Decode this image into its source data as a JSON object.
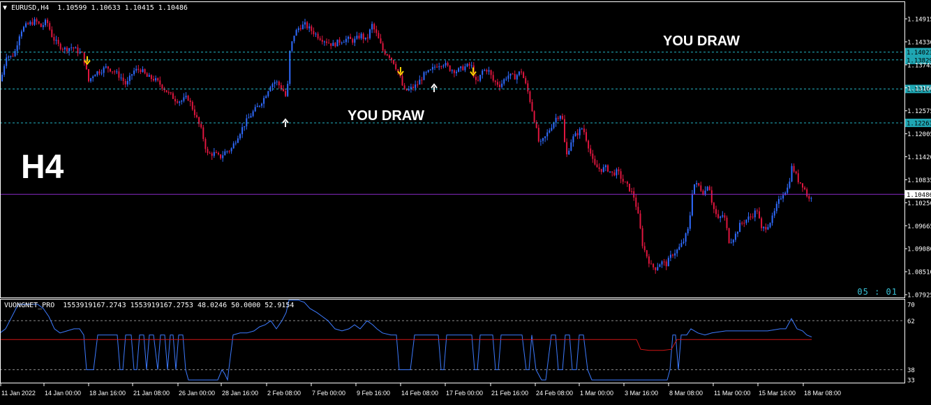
{
  "header": {
    "symbol": "EURUSD,H4",
    "ohlc": "1.10599 1.10633 1.10415 1.10486",
    "arrow_icon": "triangle-down-icon"
  },
  "overlay": {
    "timeframe": "H4",
    "label_top": "YOU DRAW",
    "label_mid": "YOU DRAW",
    "timer": "05 : 01"
  },
  "indicator": {
    "header": "VUONGNET_PRO  1553919167.2743 1553919167.2753 48.0246 50.0000 52.9154",
    "levels": [
      "70",
      "62",
      "38",
      "33"
    ],
    "colors": {
      "line": "#3d7bff",
      "signal": "#d01515",
      "level": "#8a8a8a"
    }
  },
  "chart_data": {
    "type": "candlestick",
    "symbol": "EURUSD",
    "timeframe": "H4",
    "ylim": [
      1.0792,
      1.1525
    ],
    "y_ticks": [
      "1.14915",
      "1.14330",
      "1.13745",
      "1.13160",
      "1.12575",
      "1.12005",
      "1.11420",
      "1.10835",
      "1.10250",
      "1.09665",
      "1.09080",
      "1.08510",
      "1.07925"
    ],
    "x_ticks": [
      "11 Jan 2022",
      "14 Jan 00:00",
      "18 Jan 16:00",
      "21 Jan 08:00",
      "26 Jan 00:00",
      "28 Jan 16:00",
      "2 Feb 08:00",
      "7 Feb 00:00",
      "9 Feb 16:00",
      "14 Feb 08:00",
      "17 Feb 00:00",
      "21 Feb 16:00",
      "24 Feb 08:00",
      "1 Mar 00:00",
      "3 Mar 16:00",
      "8 Mar 08:00",
      "11 Mar 00:00",
      "15 Mar 16:00",
      "18 Mar 08:00"
    ],
    "levels": [
      {
        "value": 1.14023,
        "label": "1.14023"
      },
      {
        "value": 1.13829,
        "label": "1.13829"
      },
      {
        "value": 1.13107,
        "label": "1.13107"
      },
      {
        "value": 1.12263,
        "label": "1.12263"
      }
    ],
    "current_price": {
      "value": 1.10486,
      "label": "1.10486"
    },
    "price_path": [
      [
        0,
        1.133
      ],
      [
        8,
        1.1395
      ],
      [
        14,
        1.139
      ],
      [
        20,
        1.14
      ],
      [
        28,
        1.1455
      ],
      [
        38,
        1.147
      ],
      [
        50,
        1.148
      ],
      [
        58,
        1.1465
      ],
      [
        66,
        1.148
      ],
      [
        74,
        1.144
      ],
      [
        82,
        1.142
      ],
      [
        92,
        1.141
      ],
      [
        102,
        1.1415
      ],
      [
        110,
        1.1405
      ],
      [
        118,
        1.1395
      ],
      [
        126,
        1.133
      ],
      [
        134,
        1.135
      ],
      [
        142,
        1.1355
      ],
      [
        152,
        1.1365
      ],
      [
        162,
        1.1355
      ],
      [
        172,
        1.134
      ],
      [
        180,
        1.132
      ],
      [
        190,
        1.1355
      ],
      [
        200,
        1.136
      ],
      [
        210,
        1.134
      ],
      [
        220,
        1.1335
      ],
      [
        230,
        1.132
      ],
      [
        240,
        1.13
      ],
      [
        250,
        1.1285
      ],
      [
        258,
        1.128
      ],
      [
        268,
        1.129
      ],
      [
        278,
        1.125
      ],
      [
        288,
        1.1205
      ],
      [
        296,
        1.1148
      ],
      [
        306,
        1.115
      ],
      [
        314,
        1.114
      ],
      [
        322,
        1.1155
      ],
      [
        330,
        1.116
      ],
      [
        340,
        1.1195
      ],
      [
        350,
        1.1225
      ],
      [
        360,
        1.125
      ],
      [
        370,
        1.127
      ],
      [
        378,
        1.129
      ],
      [
        386,
        1.132
      ],
      [
        394,
        1.133
      ],
      [
        404,
        1.131
      ],
      [
        410,
        1.1285
      ],
      [
        414,
        1.14
      ],
      [
        420,
        1.1445
      ],
      [
        428,
        1.1465
      ],
      [
        436,
        1.147
      ],
      [
        446,
        1.1455
      ],
      [
        456,
        1.144
      ],
      [
        466,
        1.143
      ],
      [
        476,
        1.142
      ],
      [
        486,
        1.143
      ],
      [
        496,
        1.1435
      ],
      [
        506,
        1.143
      ],
      [
        516,
        1.1445
      ],
      [
        524,
        1.143
      ],
      [
        532,
        1.147
      ],
      [
        540,
        1.144
      ],
      [
        548,
        1.1405
      ],
      [
        556,
        1.1395
      ],
      [
        564,
        1.1375
      ],
      [
        572,
        1.134
      ],
      [
        578,
        1.1305
      ],
      [
        586,
        1.131
      ],
      [
        596,
        1.132
      ],
      [
        606,
        1.1345
      ],
      [
        616,
        1.1355
      ],
      [
        624,
        1.137
      ],
      [
        634,
        1.1375
      ],
      [
        644,
        1.136
      ],
      [
        654,
        1.1355
      ],
      [
        664,
        1.1365
      ],
      [
        674,
        1.137
      ],
      [
        682,
        1.132
      ],
      [
        690,
        1.1355
      ],
      [
        698,
        1.136
      ],
      [
        706,
        1.133
      ],
      [
        716,
        1.132
      ],
      [
        726,
        1.1345
      ],
      [
        736,
        1.134
      ],
      [
        746,
        1.1355
      ],
      [
        756,
        1.13
      ],
      [
        764,
        1.124
      ],
      [
        772,
        1.117
      ],
      [
        780,
        1.119
      ],
      [
        788,
        1.1215
      ],
      [
        796,
        1.124
      ],
      [
        804,
        1.125
      ],
      [
        810,
        1.114
      ],
      [
        818,
        1.1185
      ],
      [
        826,
        1.12
      ],
      [
        834,
        1.1215
      ],
      [
        842,
        1.117
      ],
      [
        850,
        1.112
      ],
      [
        860,
        1.111
      ],
      [
        868,
        1.1115
      ],
      [
        876,
        1.11
      ],
      [
        884,
        1.1105
      ],
      [
        892,
        1.108
      ],
      [
        900,
        1.1065
      ],
      [
        908,
        1.104
      ],
      [
        914,
        1.099
      ],
      [
        920,
        1.092
      ],
      [
        926,
        1.0895
      ],
      [
        932,
        1.087
      ],
      [
        938,
        1.0865
      ],
      [
        946,
        1.088
      ],
      [
        954,
        1.0875
      ],
      [
        962,
        1.09
      ],
      [
        970,
        1.091
      ],
      [
        978,
        1.093
      ],
      [
        986,
        1.0965
      ],
      [
        992,
        1.1075
      ],
      [
        1000,
        1.107
      ],
      [
        1008,
        1.105
      ],
      [
        1014,
        1.108
      ],
      [
        1020,
        1.102
      ],
      [
        1028,
        1.0985
      ],
      [
        1036,
        1.1
      ],
      [
        1044,
        1.093
      ],
      [
        1052,
        1.0945
      ],
      [
        1060,
        1.0975
      ],
      [
        1068,
        1.0985
      ],
      [
        1076,
        1.0995
      ],
      [
        1084,
        1.101
      ],
      [
        1090,
        1.096
      ],
      [
        1098,
        1.097
      ],
      [
        1106,
        1.099
      ],
      [
        1112,
        1.102
      ],
      [
        1120,
        1.105
      ],
      [
        1128,
        1.1065
      ],
      [
        1134,
        1.112
      ],
      [
        1142,
        1.1085
      ],
      [
        1150,
        1.107
      ],
      [
        1158,
        1.1035
      ],
      [
        1163,
        1.1049
      ]
    ],
    "arrows": [
      {
        "x": 125,
        "price": 1.138,
        "dir": "down",
        "color": "#ffd400"
      },
      {
        "x": 574,
        "price": 1.1353,
        "dir": "down",
        "color": "#ffd400"
      },
      {
        "x": 678,
        "price": 1.1352,
        "dir": "down",
        "color": "#ffd400"
      },
      {
        "x": 409,
        "price": 1.1228,
        "dir": "up",
        "color": "#ffffff"
      },
      {
        "x": 622,
        "price": 1.1315,
        "dir": "up",
        "color": "#ffffff"
      }
    ],
    "colors": {
      "bull": "#2f6bff",
      "bear": "#e0163f",
      "level": "#23b5c4",
      "current": "#8a2bc7",
      "grid": "#ffffff"
    },
    "indicator_series": [
      [
        0,
        56
      ],
      [
        8,
        58
      ],
      [
        14,
        62
      ],
      [
        20,
        66
      ],
      [
        26,
        70
      ],
      [
        34,
        70
      ],
      [
        44,
        70
      ],
      [
        54,
        70
      ],
      [
        62,
        68
      ],
      [
        70,
        64
      ],
      [
        78,
        58
      ],
      [
        86,
        56
      ],
      [
        96,
        57
      ],
      [
        106,
        58
      ],
      [
        114,
        58
      ],
      [
        120,
        55
      ],
      [
        124,
        38
      ],
      [
        128,
        38
      ],
      [
        134,
        38
      ],
      [
        140,
        55
      ],
      [
        146,
        55
      ],
      [
        160,
        55
      ],
      [
        168,
        55
      ],
      [
        172,
        38
      ],
      [
        176,
        38
      ],
      [
        180,
        55
      ],
      [
        188,
        55
      ],
      [
        192,
        38
      ],
      [
        196,
        38
      ],
      [
        200,
        55
      ],
      [
        206,
        55
      ],
      [
        210,
        38
      ],
      [
        214,
        55
      ],
      [
        220,
        55
      ],
      [
        226,
        38
      ],
      [
        230,
        55
      ],
      [
        236,
        55
      ],
      [
        240,
        38
      ],
      [
        244,
        55
      ],
      [
        248,
        55
      ],
      [
        252,
        38
      ],
      [
        256,
        55
      ],
      [
        262,
        55
      ],
      [
        266,
        38
      ],
      [
        270,
        33
      ],
      [
        278,
        33
      ],
      [
        284,
        33
      ],
      [
        296,
        33
      ],
      [
        312,
        33
      ],
      [
        318,
        38
      ],
      [
        322,
        36
      ],
      [
        326,
        33
      ],
      [
        334,
        55
      ],
      [
        344,
        56
      ],
      [
        354,
        56
      ],
      [
        364,
        57
      ],
      [
        372,
        59
      ],
      [
        380,
        60
      ],
      [
        388,
        62
      ],
      [
        396,
        58
      ],
      [
        404,
        62
      ],
      [
        410,
        66
      ],
      [
        414,
        72
      ],
      [
        420,
        72
      ],
      [
        428,
        72
      ],
      [
        436,
        71
      ],
      [
        444,
        68
      ],
      [
        454,
        66
      ],
      [
        462,
        64
      ],
      [
        470,
        62
      ],
      [
        480,
        58
      ],
      [
        490,
        57
      ],
      [
        500,
        58
      ],
      [
        508,
        60
      ],
      [
        516,
        58
      ],
      [
        526,
        62
      ],
      [
        534,
        60
      ],
      [
        540,
        58
      ],
      [
        548,
        56
      ],
      [
        560,
        55
      ],
      [
        568,
        55
      ],
      [
        572,
        38
      ],
      [
        576,
        38
      ],
      [
        582,
        38
      ],
      [
        588,
        38
      ],
      [
        594,
        55
      ],
      [
        600,
        55
      ],
      [
        620,
        55
      ],
      [
        628,
        55
      ],
      [
        632,
        38
      ],
      [
        636,
        38
      ],
      [
        640,
        55
      ],
      [
        646,
        55
      ],
      [
        676,
        55
      ],
      [
        680,
        38
      ],
      [
        684,
        38
      ],
      [
        688,
        55
      ],
      [
        700,
        55
      ],
      [
        706,
        55
      ],
      [
        710,
        38
      ],
      [
        714,
        38
      ],
      [
        718,
        55
      ],
      [
        730,
        55
      ],
      [
        740,
        55
      ],
      [
        748,
        55
      ],
      [
        754,
        38
      ],
      [
        758,
        38
      ],
      [
        762,
        55
      ],
      [
        768,
        38
      ],
      [
        776,
        33
      ],
      [
        782,
        33
      ],
      [
        790,
        55
      ],
      [
        796,
        55
      ],
      [
        800,
        38
      ],
      [
        806,
        38
      ],
      [
        810,
        55
      ],
      [
        816,
        55
      ],
      [
        820,
        38
      ],
      [
        826,
        38
      ],
      [
        830,
        55
      ],
      [
        836,
        55
      ],
      [
        842,
        38
      ],
      [
        848,
        33
      ],
      [
        856,
        33
      ],
      [
        880,
        33
      ],
      [
        900,
        33
      ],
      [
        920,
        33
      ],
      [
        940,
        33
      ],
      [
        956,
        33
      ],
      [
        960,
        38
      ],
      [
        964,
        55
      ],
      [
        968,
        55
      ],
      [
        972,
        38
      ],
      [
        976,
        55
      ],
      [
        984,
        55
      ],
      [
        990,
        58
      ],
      [
        1000,
        56
      ],
      [
        1010,
        55
      ],
      [
        1020,
        56
      ],
      [
        1040,
        57
      ],
      [
        1060,
        57
      ],
      [
        1080,
        57
      ],
      [
        1100,
        57
      ],
      [
        1118,
        58
      ],
      [
        1126,
        58
      ],
      [
        1134,
        63
      ],
      [
        1142,
        58
      ],
      [
        1150,
        57
      ],
      [
        1156,
        55
      ],
      [
        1163,
        54
      ]
    ],
    "signal_series": [
      [
        0,
        52.8
      ],
      [
        900,
        52.8
      ],
      [
        912,
        52.8
      ],
      [
        918,
        48
      ],
      [
        930,
        47.5
      ],
      [
        950,
        47.5
      ],
      [
        962,
        48
      ],
      [
        970,
        52.8
      ],
      [
        1163,
        52.8
      ]
    ],
    "indicator_ylim": [
      32,
      72
    ]
  }
}
